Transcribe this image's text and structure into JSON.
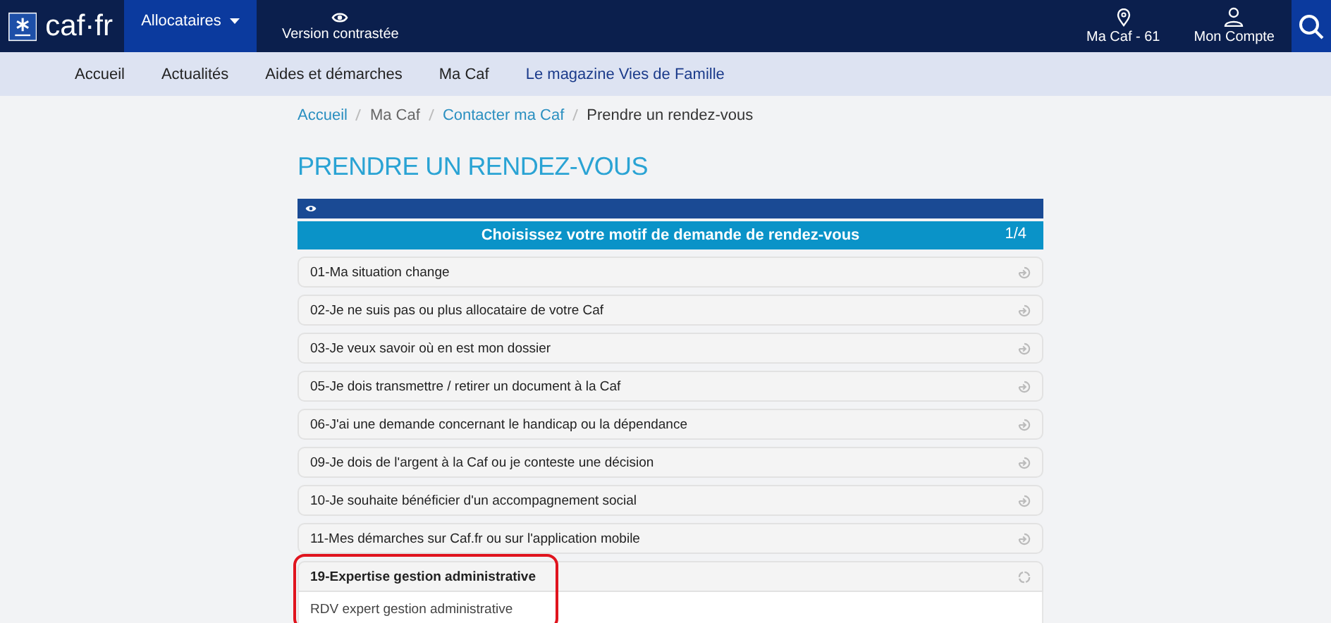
{
  "header": {
    "logo_text": "caf·fr",
    "audience_menu": {
      "label": "Allocataires",
      "selected": true
    },
    "contrast_link": "Version contrastée",
    "ma_caf": "Ma Caf - 61",
    "account": "Mon Compte"
  },
  "nav": [
    {
      "label": "Accueil",
      "selected": false
    },
    {
      "label": "Actualités",
      "selected": false
    },
    {
      "label": "Aides et démarches",
      "selected": false
    },
    {
      "label": "Ma Caf",
      "selected": false
    },
    {
      "label": "Le magazine Vies de Famille",
      "selected": false,
      "kind": "highlight"
    }
  ],
  "breadcrumb": [
    {
      "label": "Accueil",
      "kind": "link"
    },
    {
      "label": "Ma Caf",
      "kind": "plain"
    },
    {
      "label": "Contacter ma Caf",
      "kind": "link"
    },
    {
      "label": "Prendre un rendez-vous",
      "kind": "current"
    }
  ],
  "page_title": "PRENDRE UN RENDEZ-VOUS",
  "step_header": {
    "title": "Choisissez votre motif de demande de rendez-vous",
    "step": "1/4"
  },
  "motifs": [
    {
      "label": "01-Ma situation change",
      "expanded": false,
      "circled": false
    },
    {
      "label": "02-Je ne suis pas ou plus allocataire de votre Caf",
      "expanded": false,
      "circled": false
    },
    {
      "label": "03-Je veux savoir où en est mon dossier",
      "expanded": false,
      "circled": false
    },
    {
      "label": "05-Je dois transmettre / retirer un document à la Caf",
      "expanded": false,
      "circled": false
    },
    {
      "label": "06-J'ai une demande concernant le handicap ou la dépendance",
      "expanded": false,
      "circled": false
    },
    {
      "label": "09-Je dois de l'argent à la Caf ou je conteste une décision",
      "expanded": false,
      "circled": false
    },
    {
      "label": "10-Je souhaite bénéficier d'un accompagnement social",
      "expanded": false,
      "circled": false
    },
    {
      "label": "11-Mes démarches sur Caf.fr ou sur l'application mobile",
      "expanded": false,
      "circled": false
    },
    {
      "label": "19-Expertise gestion administrative",
      "expanded": true,
      "circled": true,
      "options": [
        "RDV expert gestion administrative"
      ]
    }
  ]
}
